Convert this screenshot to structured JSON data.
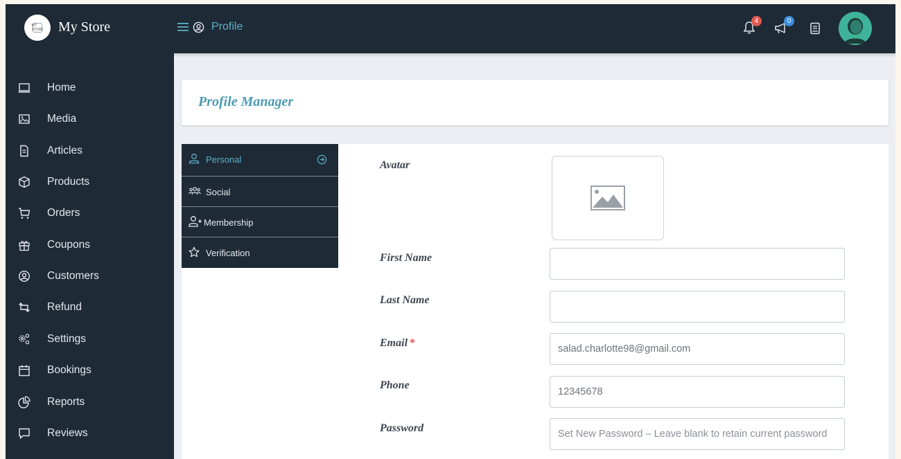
{
  "brand": {
    "name": "My Store",
    "logo_text": "MY STORE"
  },
  "breadcrumb": {
    "label": "Profile"
  },
  "notifications": {
    "bell_count": "4",
    "announce_count": "0"
  },
  "colors": {
    "sidebar": "#1e2a35",
    "accent": "#5fb0c9",
    "bell_badge": "#e05a52",
    "announce_badge": "#3d8fe0",
    "avatar": "#3fb39a"
  },
  "sidebar": {
    "items": [
      {
        "label": "Home",
        "icon": "laptop-icon"
      },
      {
        "label": "Media",
        "icon": "image-icon"
      },
      {
        "label": "Articles",
        "icon": "document-icon"
      },
      {
        "label": "Products",
        "icon": "box-icon"
      },
      {
        "label": "Orders",
        "icon": "cart-icon"
      },
      {
        "label": "Coupons",
        "icon": "gift-icon"
      },
      {
        "label": "Customers",
        "icon": "user-circle-icon"
      },
      {
        "label": "Refund",
        "icon": "refund-icon"
      },
      {
        "label": "Settings",
        "icon": "gears-icon"
      },
      {
        "label": "Bookings",
        "icon": "calendar-icon"
      },
      {
        "label": "Reports",
        "icon": "pie-chart-icon"
      },
      {
        "label": "Reviews",
        "icon": "comment-icon"
      }
    ]
  },
  "page": {
    "title": "Profile Manager"
  },
  "tabs": [
    {
      "label": "Personal",
      "icon": "user-icon",
      "active": true
    },
    {
      "label": "Social",
      "icon": "users-icon",
      "active": false
    },
    {
      "label": "Membership",
      "icon": "user-plus-icon",
      "active": false
    },
    {
      "label": "Verification",
      "icon": "star-icon",
      "active": false
    }
  ],
  "form": {
    "avatar_label": "Avatar",
    "first_name_label": "First Name",
    "first_name_value": "",
    "last_name_label": "Last Name",
    "last_name_value": "",
    "email_label": "Email",
    "email_required_mark": "*",
    "email_value": "salad.charlotte98@gmail.com",
    "phone_label": "Phone",
    "phone_value": "12345678",
    "password_label": "Password",
    "password_placeholder": "Set New Password – Leave blank to retain current password"
  }
}
